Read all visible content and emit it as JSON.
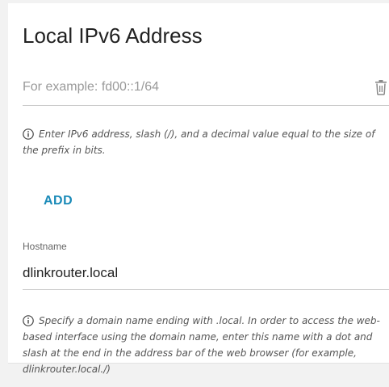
{
  "section": {
    "title": "Local IPv6 Address"
  },
  "ipv6_field": {
    "placeholder": "For example: fd00::1/64",
    "value": "",
    "delete_icon": "trash-icon"
  },
  "ipv6_hint": {
    "icon": "info-icon",
    "text": "Enter IPv6 address, slash (/), and a decimal value equal to the size of the prefix in bits."
  },
  "add_button": {
    "label": "ADD",
    "color": "#1a8ab8"
  },
  "hostname": {
    "label": "Hostname",
    "value": "dlinkrouter.local"
  },
  "hostname_hint": {
    "icon": "info-icon",
    "text": "Specify a domain name ending with .local. In order to access the web-based interface using the domain name, enter this name with a dot and slash at the end in the address bar of the web browser (for example, dlinkrouter.local./)"
  }
}
